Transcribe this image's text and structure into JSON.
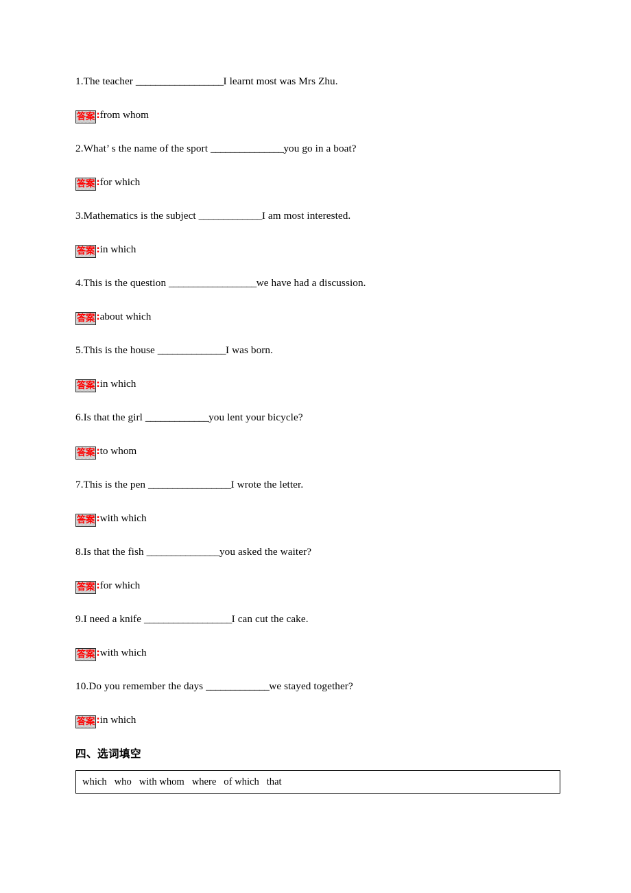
{
  "document": {
    "exercises": [
      {
        "number": "1.",
        "text_before": "The teacher ",
        "blank": "__________________",
        "text_after": "I learnt most was Mrs Zhu.",
        "answer_label": "答案",
        "answer_colon": ":",
        "answer": "from whom"
      },
      {
        "number": "2.",
        "text_before": "What’ s the name of the sport ",
        "blank": "_______________",
        "text_after": "you go in a boat?",
        "answer_label": "答案",
        "answer_colon": ":",
        "answer": "for which"
      },
      {
        "number": "3.",
        "text_before": "Mathematics is the subject ",
        "blank": "_____________",
        "text_after": "I am most interested.",
        "answer_label": "答案",
        "answer_colon": ":",
        "answer": "in which"
      },
      {
        "number": "4.",
        "text_before": "This is the question ",
        "blank": "__________________",
        "text_after": "we have had a discussion.",
        "answer_label": "答案",
        "answer_colon": ":",
        "answer": "about which"
      },
      {
        "number": "5.",
        "text_before": "This is the house ",
        "blank": "______________",
        "text_after": "I was born.",
        "answer_label": "答案",
        "answer_colon": ":",
        "answer": "in which"
      },
      {
        "number": "6.",
        "text_before": "Is that the girl ",
        "blank": "_____________",
        "text_after": "you lent your bicycle?",
        "answer_label": "答案",
        "answer_colon": ":",
        "answer": "to whom"
      },
      {
        "number": "7.",
        "text_before": "This is the pen ",
        "blank": "_________________",
        "text_after": "I wrote the letter.",
        "answer_label": "答案",
        "answer_colon": ":",
        "answer": "with which"
      },
      {
        "number": "8.",
        "text_before": "Is that the fish ",
        "blank": "_______________",
        "text_after": "you asked the waiter?",
        "answer_label": "答案",
        "answer_colon": ":",
        "answer": "for which"
      },
      {
        "number": "9.",
        "text_before": "I need a knife ",
        "blank": "__________________",
        "text_after": "I can cut the cake.",
        "answer_label": "答案",
        "answer_colon": ":",
        "answer": "with which"
      },
      {
        "number": "10.",
        "text_before": "Do you remember the days ",
        "blank": "_____________",
        "text_after": "we stayed together?",
        "answer_label": "答案",
        "answer_colon": ":",
        "answer": "in which"
      }
    ],
    "section": {
      "heading": "四、选词填空",
      "word_bank": "which   who   with whom   where   of which   that"
    },
    "colors": {
      "answer_label_red": "#ff0000",
      "answer_label_bg": "#dcdcdc",
      "text_black": "#000000",
      "page_background": "#ffffff",
      "border_black": "#000000"
    }
  }
}
